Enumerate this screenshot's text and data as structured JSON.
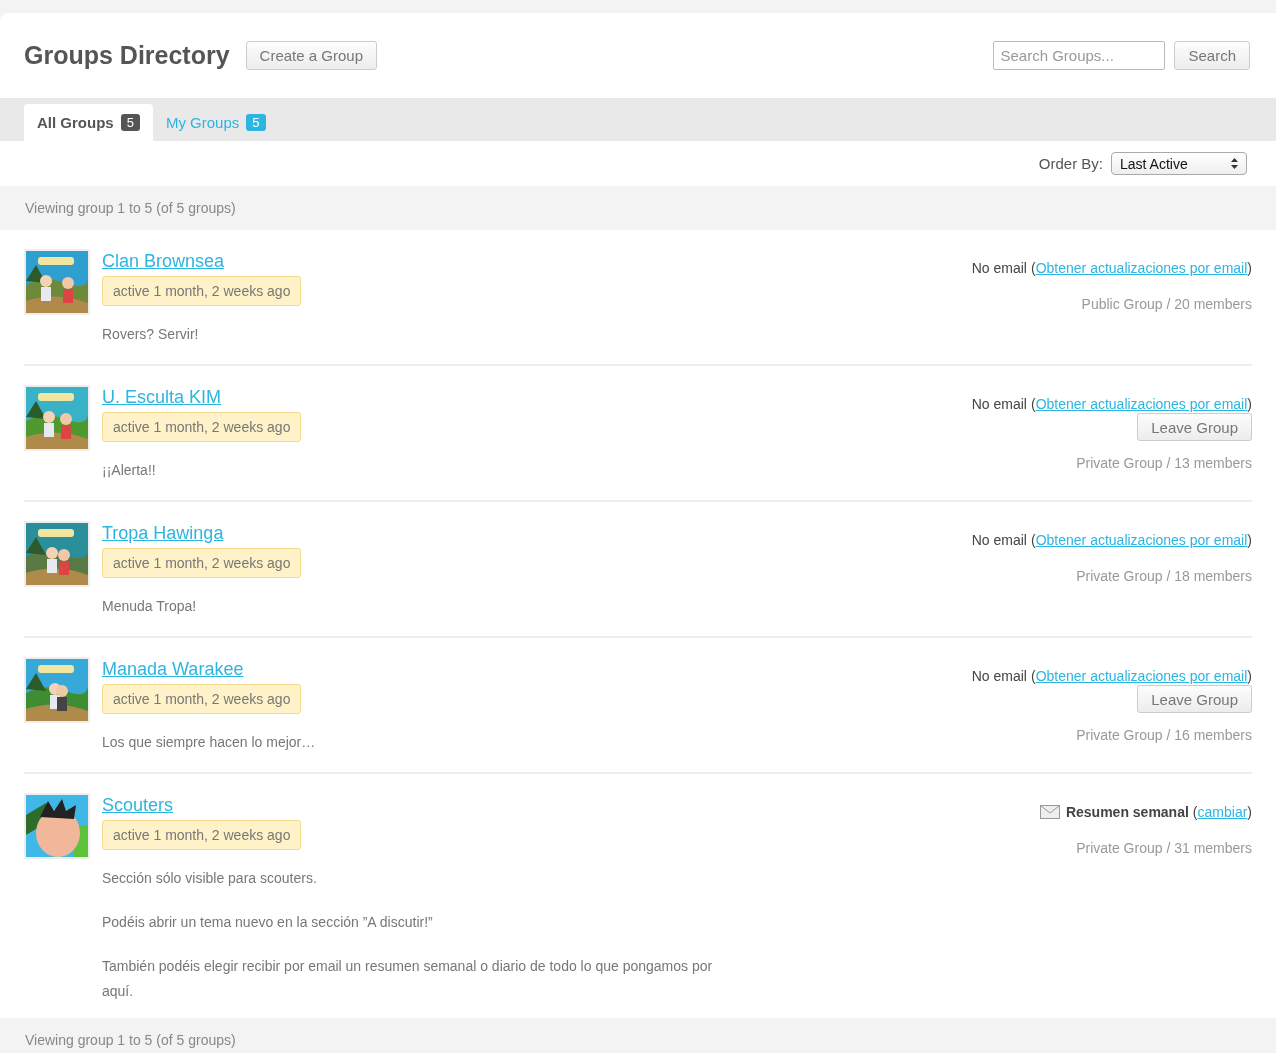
{
  "header": {
    "title": "Groups Directory",
    "create_button": "Create a Group",
    "search_placeholder": "Search Groups...",
    "search_button": "Search"
  },
  "tabs": [
    {
      "label": "All Groups",
      "count": "5",
      "selected": true
    },
    {
      "label": "My Groups",
      "count": "5",
      "selected": false
    }
  ],
  "order_by": {
    "label": "Order By:",
    "value": "Last Active"
  },
  "pagination_top": "Viewing group 1 to 5 (of 5 groups)",
  "groups": [
    {
      "name": "Clan Brownsea",
      "activity": "active 1 month, 2 weeks ago",
      "description": [
        "Rovers? Servir!"
      ],
      "email": {
        "kind": "none",
        "status": "No email",
        "open": "(",
        "link": "Obtener actualizaciones por email",
        "close": ")"
      },
      "info": "Public Group / 20 members"
    },
    {
      "name": "U. Esculta KIM",
      "activity": "active 1 month, 2 weeks ago",
      "description": [
        "¡¡Alerta!!"
      ],
      "email": {
        "kind": "none",
        "status": "No email",
        "open": "(",
        "link": "Obtener actualizaciones por email",
        "close": ")"
      },
      "leave_button": "Leave Group",
      "info": "Private Group / 13 members"
    },
    {
      "name": "Tropa Hawinga",
      "activity": "active 1 month, 2 weeks ago",
      "description": [
        "Menuda Tropa!"
      ],
      "email": {
        "kind": "none",
        "status": "No email",
        "open": "(",
        "link": "Obtener actualizaciones por email",
        "close": ")"
      },
      "info": "Private Group / 18 members"
    },
    {
      "name": "Manada Warakee",
      "activity": "active 1 month, 2 weeks ago",
      "description": [
        "Los que siempre hacen lo mejor…"
      ],
      "email": {
        "kind": "none",
        "status": "No email",
        "open": "(",
        "link": "Obtener actualizaciones por email",
        "close": ")"
      },
      "leave_button": "Leave Group",
      "info": "Private Group / 16 members"
    },
    {
      "name": "Scouters",
      "activity": "active 1 month, 2 weeks ago",
      "description": [
        "Sección sólo visible para scouters.",
        "Podéis abrir un tema nuevo en la sección ”A discutir!”",
        "También podéis elegir recibir por email un resumen semanal o diario de todo lo que pongamos por aquí."
      ],
      "email": {
        "kind": "digest",
        "status": "Resumen semanal",
        "open": "(",
        "link": "cambiar",
        "close": ")"
      },
      "info": "Private Group / 31 members"
    }
  ],
  "pagination_bottom": "Viewing group 1 to 5 (of 5 groups)"
}
